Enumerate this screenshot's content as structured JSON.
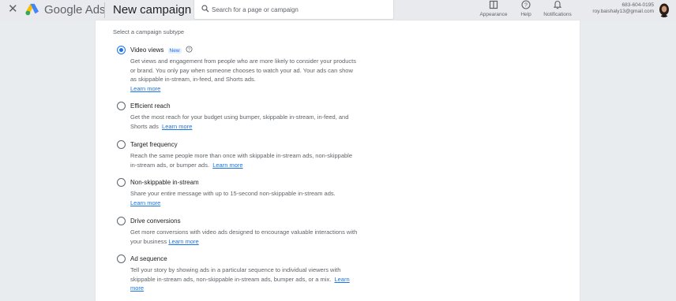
{
  "header": {
    "close_icon": "close-icon",
    "brand": "Google Ads",
    "page_title": "New campaign",
    "search_placeholder": "Search for a page or campaign",
    "tools": [
      {
        "label": "Appearance",
        "icon": "appearance-icon"
      },
      {
        "label": "Help",
        "icon": "help-icon"
      },
      {
        "label": "Notifications",
        "icon": "bell-icon"
      }
    ],
    "account": {
      "id": "683-604-0195",
      "email": "roy.baishaly13@gmail.com"
    }
  },
  "subtype": {
    "section_label": "Select a campaign subtype",
    "learn_more": "Learn more",
    "options": [
      {
        "title": "Video views",
        "badge": "New",
        "selected": true,
        "description": "Get views and engagement from people who are more likely to consider your products or brand. You only pay when someone chooses to watch your ad. Your ads can show as skippable in-stream, in-feed, and Shorts ads."
      },
      {
        "title": "Efficient reach",
        "selected": false,
        "description": "Get the most reach for your budget using bumper, skippable in-stream, in-feed, and Shorts ads"
      },
      {
        "title": "Target frequency",
        "selected": false,
        "description": "Reach the same people more than once with skippable in-stream ads, non-skippable in-stream ads, or bumper ads."
      },
      {
        "title": "Non-skippable in-stream",
        "selected": false,
        "description": "Share your entire message with up to 15-second non-skippable in-stream ads."
      },
      {
        "title": "Drive conversions",
        "selected": false,
        "description": "Get more conversions with video ads designed to encourage valuable interactions with your business"
      },
      {
        "title": "Ad sequence",
        "selected": false,
        "description": "Tell your story by showing ads in a particular sequence to individual viewers with skippable in-stream ads, non-skippable in-stream ads, bumper ads, or a mix."
      }
    ]
  },
  "colors": {
    "accent": "#1a73e8",
    "top_bar": "#e8eaed",
    "background": "#e9ecef"
  }
}
